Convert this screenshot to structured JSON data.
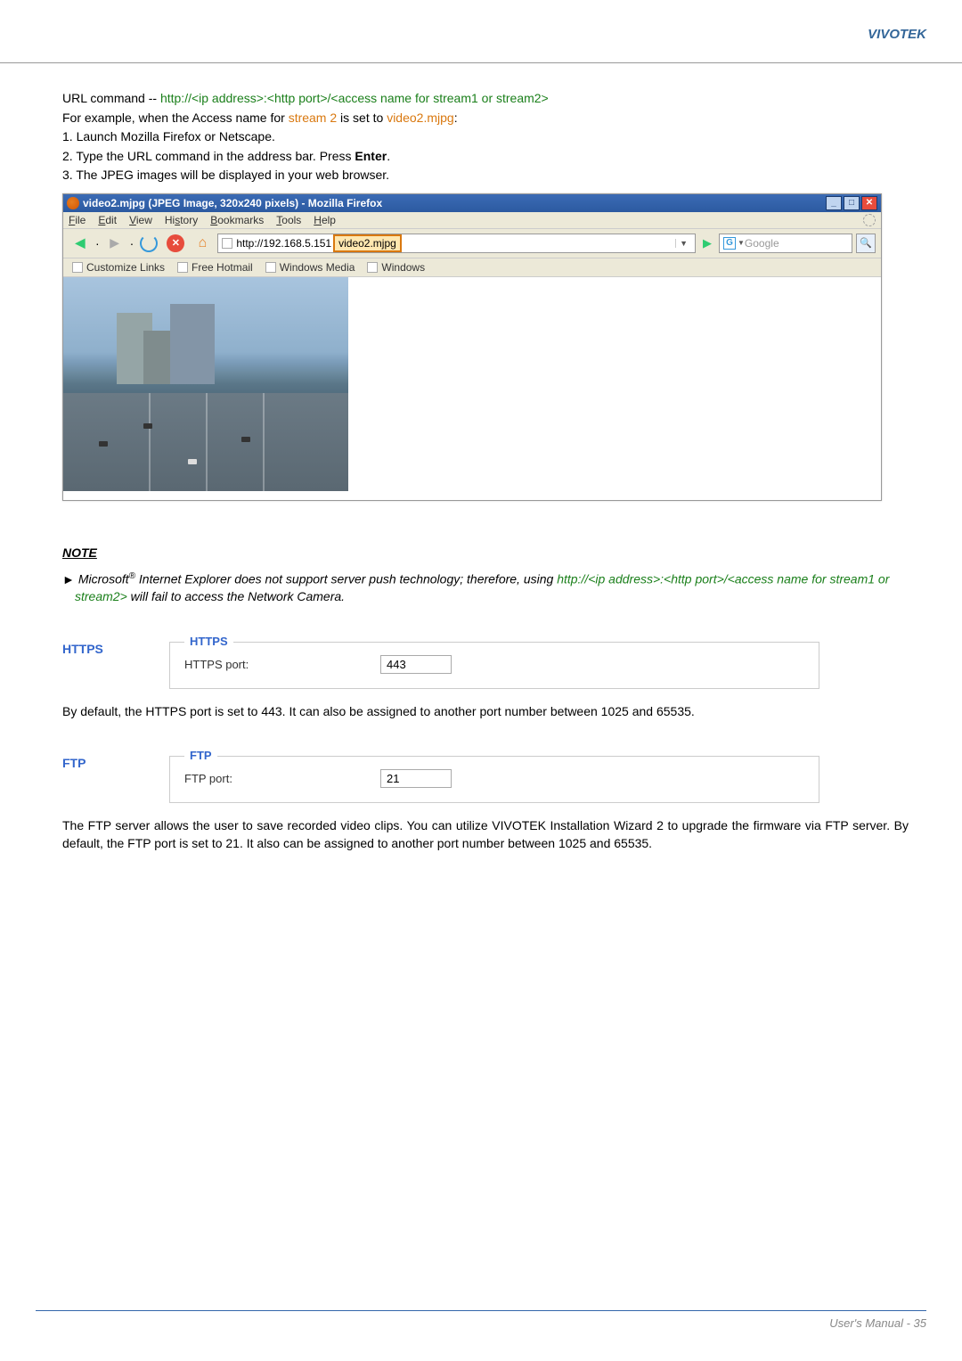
{
  "header": {
    "brand": "VIVOTEK"
  },
  "urlSection": {
    "urlCmdPrefix": "URL command -- ",
    "urlCmd": "http://<ip address>:<http port>/<access name for stream1 or stream2>",
    "examplePrefix": "For example, when the Access name for ",
    "stream": "stream 2",
    "exampleMid": " is set to ",
    "filename": "video2.mjpg",
    "exampleSuffix": ":",
    "step1": "1. Launch Mozilla Firefox or Netscape.",
    "step2a": "2. Type the URL command in the address bar. Press ",
    "step2b": "Enter",
    "step2c": ".",
    "step3": "3. The JPEG images will be displayed in your web browser."
  },
  "browser": {
    "title": "video2.mjpg (JPEG Image, 320x240 pixels) - Mozilla Firefox",
    "menu": {
      "file": "File",
      "edit": "Edit",
      "view": "View",
      "history": "History",
      "bookmarks": "Bookmarks",
      "tools": "Tools",
      "help": "Help"
    },
    "url": "http://192.168.5.151",
    "urlHighlight": "video2.mjpg",
    "searchProvider": "G",
    "searchPlaceholder": "Google",
    "bookmarks": {
      "b1": "Customize Links",
      "b2": "Free Hotmail",
      "b3": "Windows Media",
      "b4": "Windows"
    }
  },
  "note": {
    "heading": "NOTE",
    "arrow": "►",
    "prefix": "Microsoft",
    "reg": "®",
    "mid": " Internet Explorer does not support server push technology; therefore, using ",
    "link": "http://<ip address>:<http port>/<access name for stream1 or stream2>",
    "suffix": " will fail to access the Network Camera."
  },
  "https": {
    "title": "HTTPS",
    "legend": "HTTPS",
    "label": "HTTPS port:",
    "value": "443",
    "desc": "By default, the HTTPS port is set to 443. It can also be assigned to another port number between 1025 and 65535."
  },
  "ftp": {
    "title": "FTP",
    "legend": "FTP",
    "label": "FTP port:",
    "value": "21",
    "desc": "The FTP server allows the user to save recorded video clips. You can utilize VIVOTEK Installation Wizard 2 to upgrade the firmware via FTP server. By default, the FTP port is set to 21. It also can be assigned to another port number between 1025 and 65535."
  },
  "footer": {
    "text": "User's Manual - 35"
  }
}
